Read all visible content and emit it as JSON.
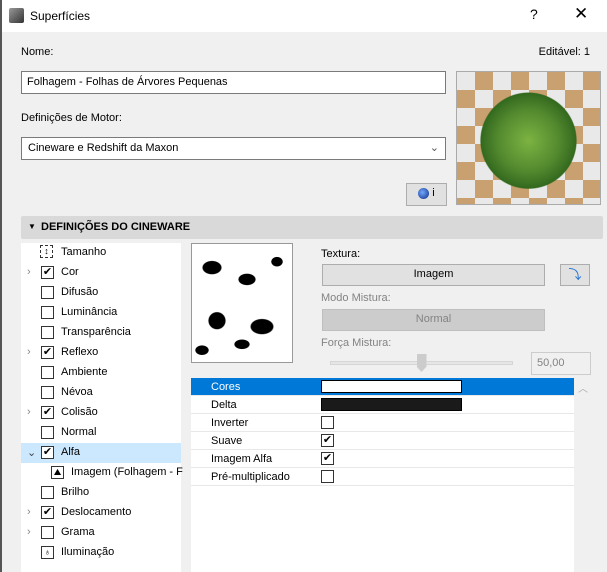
{
  "window": {
    "title": "Superfícies",
    "help": "?",
    "close": "✕"
  },
  "name_label": "Nome:",
  "editable": "Editável: 1",
  "name_value": "Folhagem - Folhas de Árvores Pequenas",
  "engine_label": "Definições de Motor:",
  "engine_value": "Cineware e Redshift da Maxon",
  "info_button": "i",
  "section_title": "DEFINIÇÕES DO CINEWARE",
  "tree": [
    {
      "label": "Tamanho",
      "expand": false,
      "check": null,
      "icon": "size"
    },
    {
      "label": "Cor",
      "expand": true,
      "check": true
    },
    {
      "label": "Difusão",
      "expand": false,
      "check": false
    },
    {
      "label": "Luminância",
      "expand": false,
      "check": false
    },
    {
      "label": "Transparência",
      "expand": false,
      "check": false
    },
    {
      "label": "Reflexo",
      "expand": true,
      "check": true
    },
    {
      "label": "Ambiente",
      "expand": false,
      "check": false
    },
    {
      "label": "Névoa",
      "expand": false,
      "check": false
    },
    {
      "label": "Colisão",
      "expand": true,
      "check": true
    },
    {
      "label": "Normal",
      "expand": false,
      "check": false
    },
    {
      "label": "Alfa",
      "expand": "open",
      "check": true,
      "selected": true
    },
    {
      "label": "Imagem (Folhagem - F",
      "child": true,
      "icon": "image"
    },
    {
      "label": "Brilho",
      "expand": false,
      "check": false
    },
    {
      "label": "Deslocamento",
      "expand": true,
      "check": true
    },
    {
      "label": "Grama",
      "expand": true,
      "check": false
    },
    {
      "label": "Iluminação",
      "expand": false,
      "check": null,
      "icon": "light"
    }
  ],
  "texture": {
    "label": "Textura:",
    "button": "Imagem",
    "blend_mode_label": "Modo Mistura:",
    "blend_mode": "Normal",
    "blend_strength_label": "Força Mistura:",
    "blend_strength": "50,00",
    "slider_fraction": 0.5
  },
  "props": [
    {
      "label": "Cores",
      "type": "color",
      "color": "#ffffff",
      "selected": true
    },
    {
      "label": "Delta",
      "type": "color",
      "color": "#1a1a1a"
    },
    {
      "label": "Inverter",
      "type": "check",
      "checked": false
    },
    {
      "label": "Suave",
      "type": "check",
      "checked": true
    },
    {
      "label": "Imagem Alfa",
      "type": "check",
      "checked": true
    },
    {
      "label": "Pré-multiplicado",
      "type": "check",
      "checked": false
    }
  ]
}
